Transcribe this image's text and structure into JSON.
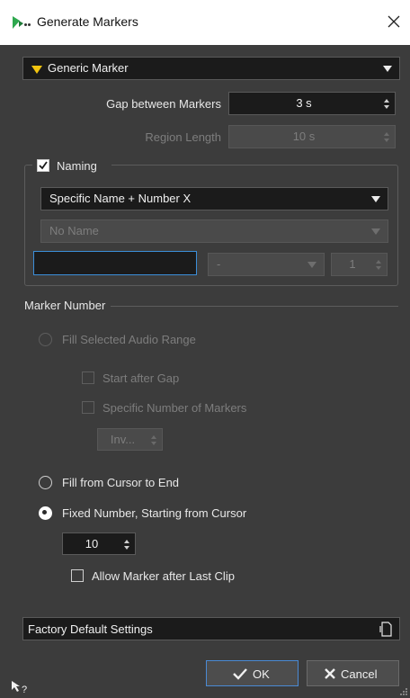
{
  "window": {
    "title": "Generate Markers",
    "icon": "app-logo-icon"
  },
  "marker_type": {
    "selected": "Generic Marker",
    "icon": "yellow-triangle-icon",
    "icon_color": "#f2c40f"
  },
  "gap": {
    "label": "Gap between Markers",
    "value": "3 s"
  },
  "region": {
    "label": "Region Length",
    "value": "10 s"
  },
  "naming": {
    "label": "Naming",
    "checked": true,
    "scheme": "Specific Name + Number X",
    "name_select": "No Name",
    "name_input": "",
    "separator": "-",
    "start_number": "1"
  },
  "marker_number": {
    "label": "Marker Number",
    "fill_range": "Fill Selected Audio Range",
    "start_after_gap": "Start after Gap",
    "specific_number": "Specific Number of Markers",
    "inv_value": "Inv...",
    "fill_cursor": "Fill from Cursor to End",
    "fixed_number": "Fixed Number, Starting from Cursor",
    "fixed_value": "10",
    "allow_after_last": "Allow Marker after Last Clip"
  },
  "preset": {
    "label": "Factory Default Settings",
    "icon": "preset-menu-icon"
  },
  "buttons": {
    "ok": "OK",
    "cancel": "Cancel"
  },
  "colors": {
    "background": "#3c3c3c",
    "field": "#1b1b1b",
    "focus_border": "#3b8ed8",
    "ok_border": "#4a8ad4"
  }
}
